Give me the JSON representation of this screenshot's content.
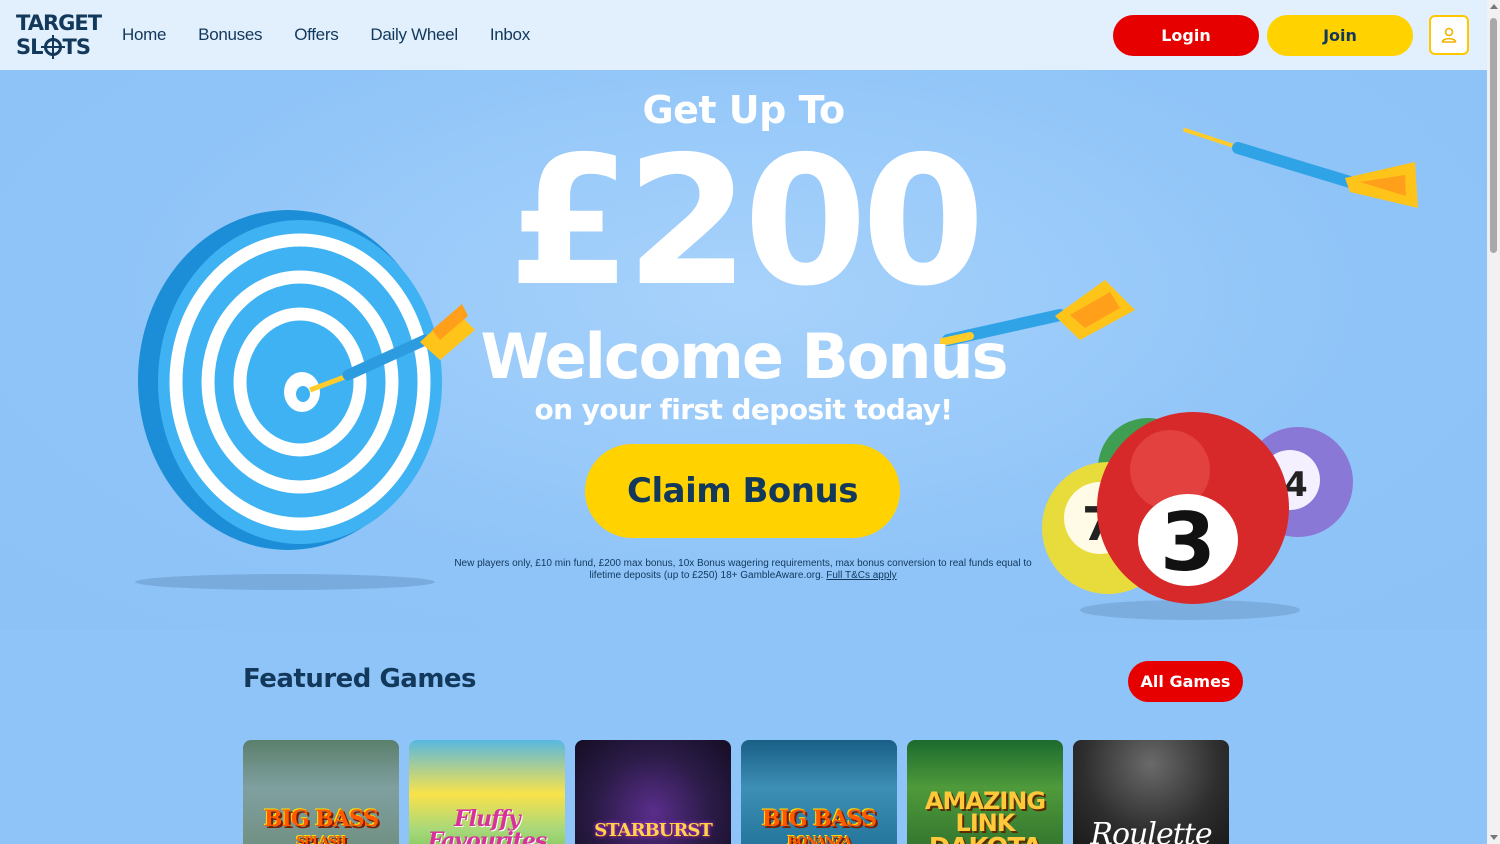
{
  "brand": {
    "line1": "TARGET",
    "line2_left": "SL",
    "line2_right": "TS"
  },
  "nav": {
    "items": [
      "Home",
      "Bonuses",
      "Offers",
      "Daily Wheel",
      "Inbox"
    ]
  },
  "header": {
    "login_label": "Login",
    "join_label": "Join",
    "account_icon": "user-icon"
  },
  "hero": {
    "kicker": "Get Up To",
    "amount": "£200",
    "headline": "Welcome Bonus",
    "subline": "on your first deposit today!",
    "cta_label": "Claim Bonus",
    "terms_text": "New players only, £10 min fund, £200 max bonus, 10x Bonus wagering requirements, max bonus conversion to real funds equal to lifetime deposits (up to £250) 18+ GambleAware.org.",
    "terms_link": "Full T&Cs apply",
    "ball_number": "3",
    "ball_left_number": "7",
    "ball_right_number": "4"
  },
  "featured": {
    "title": "Featured Games",
    "all_games_label": "All Games",
    "games": [
      {
        "title": "BIG BASS",
        "subtitle": "SPLASH"
      },
      {
        "title": "Fluffy Favourites",
        "subtitle": ""
      },
      {
        "title": "STARBURST",
        "subtitle": ""
      },
      {
        "title": "BIG BASS",
        "subtitle": "BONANZA"
      },
      {
        "title": "AMAZING LINK",
        "subtitle": "DAKOTA"
      },
      {
        "title": "Roulette",
        "subtitle": ""
      }
    ]
  },
  "colors": {
    "accent_red": "#e60000",
    "accent_yellow": "#ffd200",
    "navy": "#12385c",
    "hero_blue": "#8fc4f8"
  }
}
